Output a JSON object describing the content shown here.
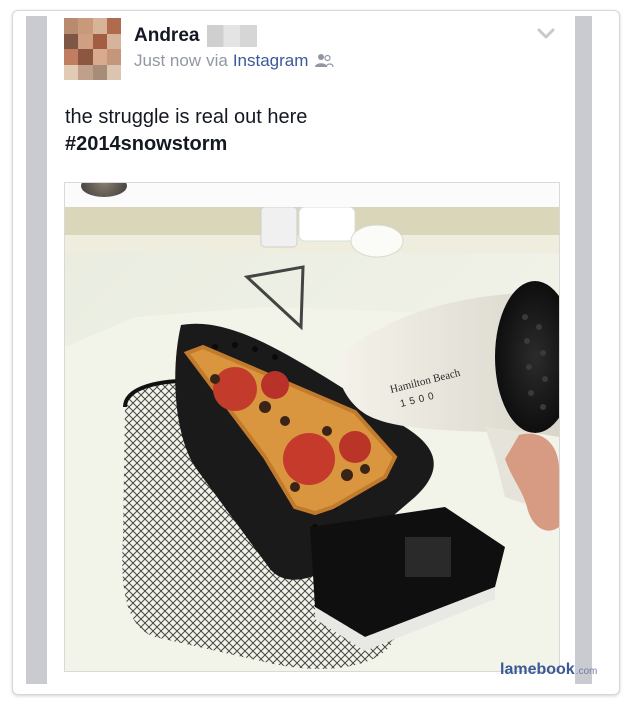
{
  "post": {
    "author_name": "Andrea",
    "timestamp": "Just now",
    "via_label": "via",
    "app_name": "Instagram",
    "audience_icon": "friends-icon",
    "message_line1": "the struggle is real out here",
    "hashtag": "#2014snowstorm"
  },
  "photo": {
    "dryer_brand": "Hamilton Beach",
    "dryer_model": "1500"
  },
  "watermark": {
    "name": "lamebook",
    "domain": ".com"
  },
  "colors": {
    "link_blue": "#3b5998",
    "meta_gray": "#9197a3",
    "text_dark": "#141823"
  }
}
